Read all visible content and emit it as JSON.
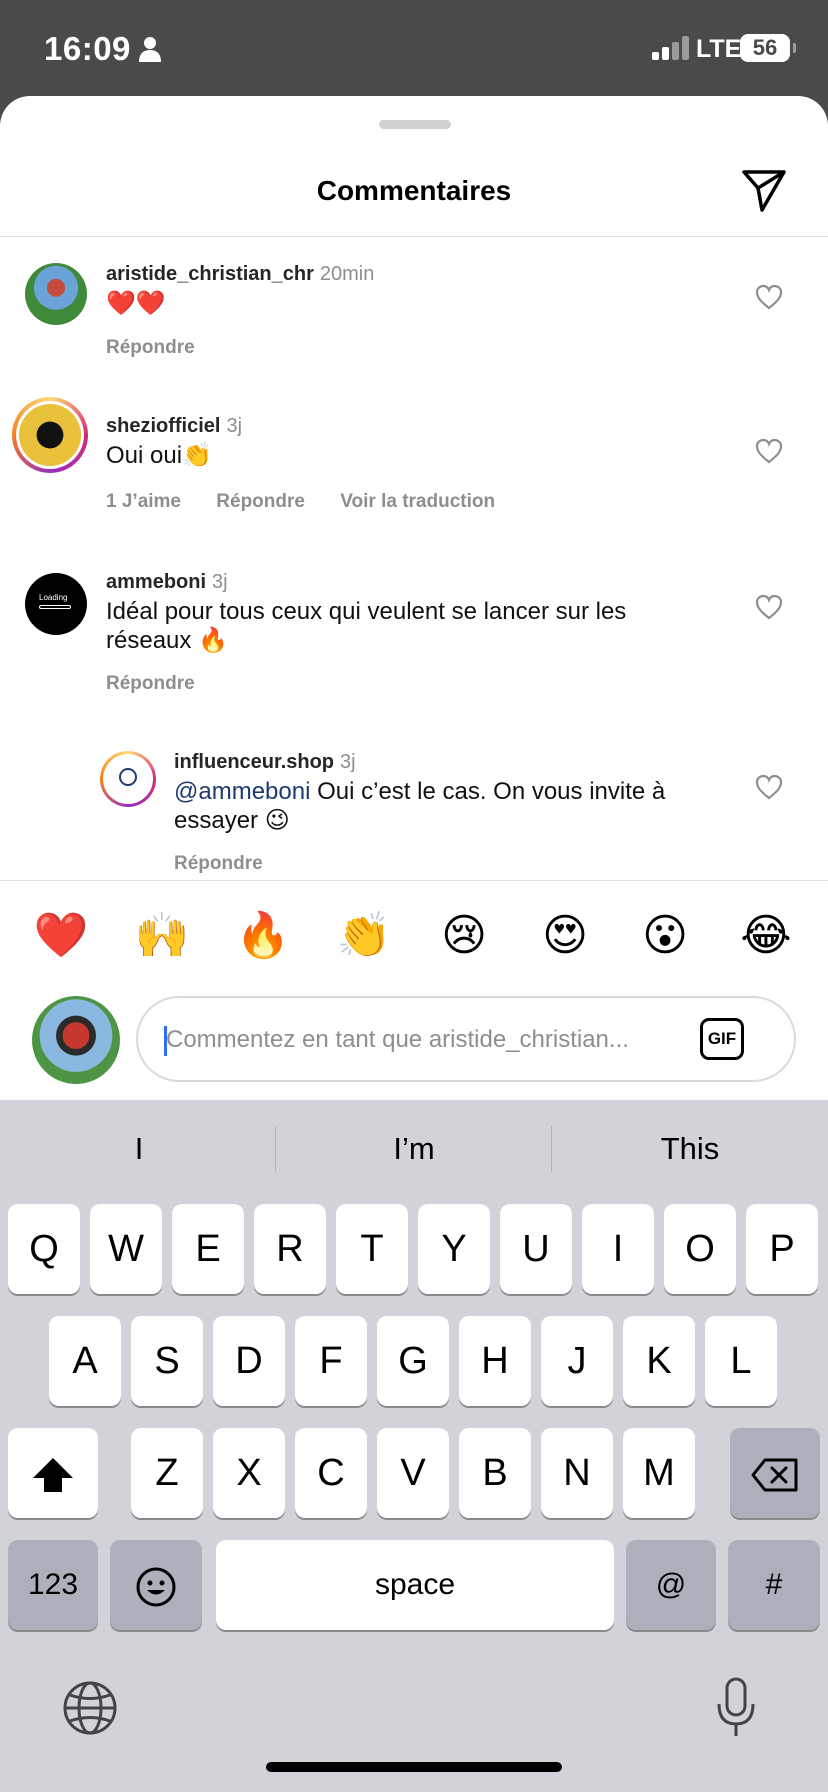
{
  "status_bar": {
    "time": "16:09",
    "network": "LTE",
    "battery": "56"
  },
  "sheet": {
    "title": "Commentaires"
  },
  "comments": [
    {
      "username": "aristide_christian_chr",
      "time": "20min",
      "text": "❤️❤️",
      "actions": [
        "Répondre"
      ]
    },
    {
      "username": "sheziofficiel",
      "time": "3j",
      "text": "Oui oui👏",
      "actions": [
        "1 J’aime",
        "Répondre",
        "Voir la traduction"
      ]
    },
    {
      "username": "ammeboni",
      "time": "3j",
      "text": "Idéal pour tous ceux qui veulent se lancer sur les réseaux 🔥",
      "actions": [
        "Répondre"
      ],
      "avatar_text": "Loading"
    },
    {
      "username": "influenceur.shop",
      "time": "3j",
      "mention": "@ammeboni",
      "text": " Oui c’est le cas. On vous invite à essayer 😉",
      "actions": [
        "Répondre"
      ]
    }
  ],
  "reactions": [
    "❤️",
    "🙌",
    "🔥",
    "👏",
    "😢",
    "😍",
    "😮",
    "😂"
  ],
  "composer": {
    "placeholder": "Commentez en tant que aristide_christian...",
    "gif_label": "GIF"
  },
  "keyboard": {
    "suggestions": [
      "I",
      "I’m",
      "This"
    ],
    "row1": [
      "Q",
      "W",
      "E",
      "R",
      "T",
      "Y",
      "U",
      "I",
      "O",
      "P"
    ],
    "row2": [
      "A",
      "S",
      "D",
      "F",
      "G",
      "H",
      "J",
      "K",
      "L"
    ],
    "row3": [
      "Z",
      "X",
      "C",
      "V",
      "B",
      "N",
      "M"
    ],
    "numbers_label": "123",
    "space_label": "space",
    "at_label": "@",
    "hash_label": "#"
  },
  "colors": {
    "accent_mention": "#1e3a6e",
    "cursor": "#2f6df6",
    "heart_red": "#e0245e"
  },
  "icons": [
    "person-icon",
    "send-icon",
    "heart-icon",
    "gif-icon",
    "shift-icon",
    "backspace-icon",
    "emoji-icon",
    "globe-icon",
    "microphone-icon"
  ]
}
